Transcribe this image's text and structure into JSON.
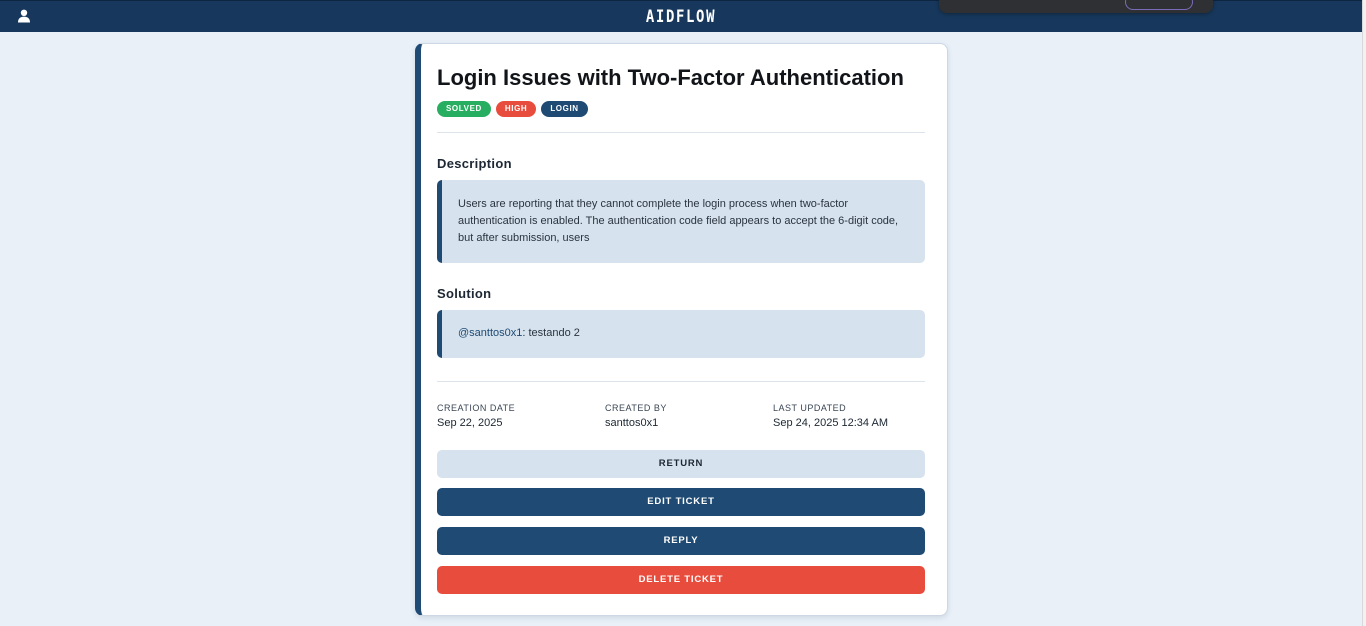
{
  "app": {
    "brand": "AIDFLOW"
  },
  "icons": {
    "user": "user-icon"
  },
  "ticket": {
    "title": "Login Issues with Two-Factor Authentication",
    "tags": [
      {
        "label": "SOLVED",
        "color": "#27ae60"
      },
      {
        "label": "HIGH",
        "color": "#e74c3c"
      },
      {
        "label": "LOGIN",
        "color": "#1e4a73"
      }
    ],
    "description_heading": "Description",
    "description": "Users are reporting that they cannot complete the login process when two-factor authentication is enabled. The authentication code field appears to accept the 6-digit code, but after submission, users",
    "solution_heading": "Solution",
    "solution": {
      "mention": "@santtos0x1",
      "text": ": testando 2"
    },
    "meta": {
      "creation_label": "CREATION DATE",
      "creation_value": "Sep 22, 2025",
      "created_by_label": "CREATED BY",
      "created_by_value": "santtos0x1",
      "updated_label": "LAST UPDATED",
      "updated_value": "Sep 24, 2025 12:34 AM"
    },
    "buttons": {
      "return": "RETURN",
      "edit": "EDIT TICKET",
      "reply": "REPLY",
      "delete": "DELETE TICKET"
    }
  },
  "colors": {
    "navbar": "#17385c",
    "accent": "#1e4a73",
    "success": "#27ae60",
    "danger": "#e74c3c",
    "background": "#e9f0f8"
  }
}
